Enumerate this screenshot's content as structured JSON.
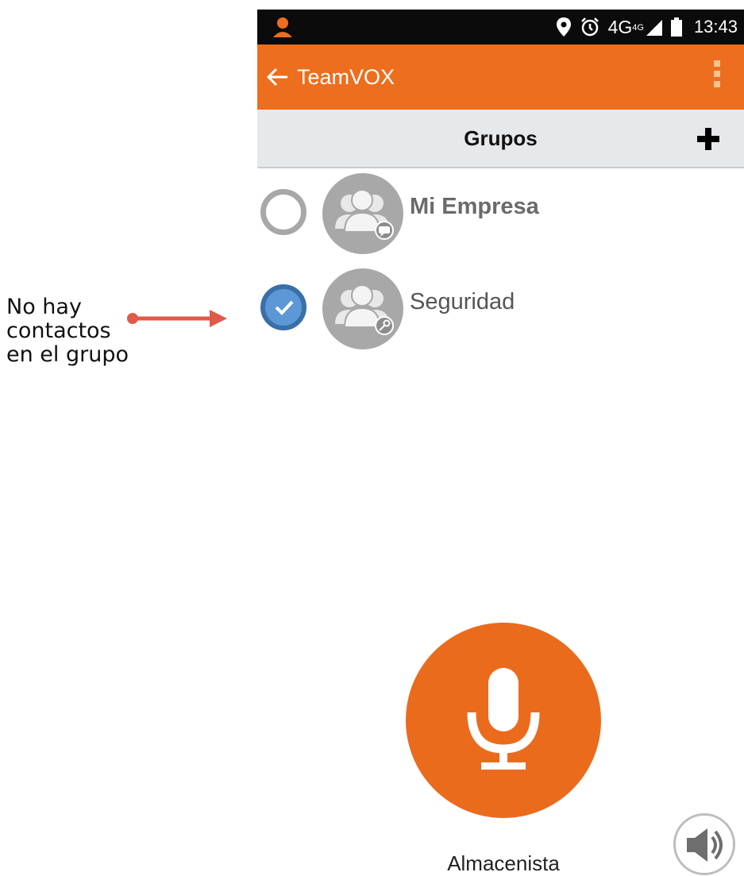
{
  "status_bar": {
    "network": "4G",
    "network_superscript": "4G",
    "time": "13:43",
    "icons": [
      "user-icon",
      "location-icon",
      "alarm-icon",
      "signal-icon",
      "battery-icon"
    ]
  },
  "app_bar": {
    "title": "TeamVOX",
    "color": "#ec6e1e",
    "icons": [
      "back-arrow-icon",
      "overflow-menu-icon"
    ]
  },
  "groups_header": {
    "title": "Grupos",
    "add_icon": "plus-icon"
  },
  "groups": [
    {
      "name": "Mi Empresa",
      "selected": false,
      "badge_icon": "chat-badge-icon"
    },
    {
      "name": "Seguridad",
      "selected": true,
      "badge_icon": "key-badge-icon"
    }
  ],
  "annotation": {
    "lines": [
      "No hay",
      "contactos",
      "en el grupo"
    ],
    "color": "#e05a4a"
  },
  "ptt": {
    "label": "Almacenista",
    "icon": "microphone-icon",
    "color": "#eb6b1d"
  },
  "speaker": {
    "icon": "speaker-icon"
  }
}
